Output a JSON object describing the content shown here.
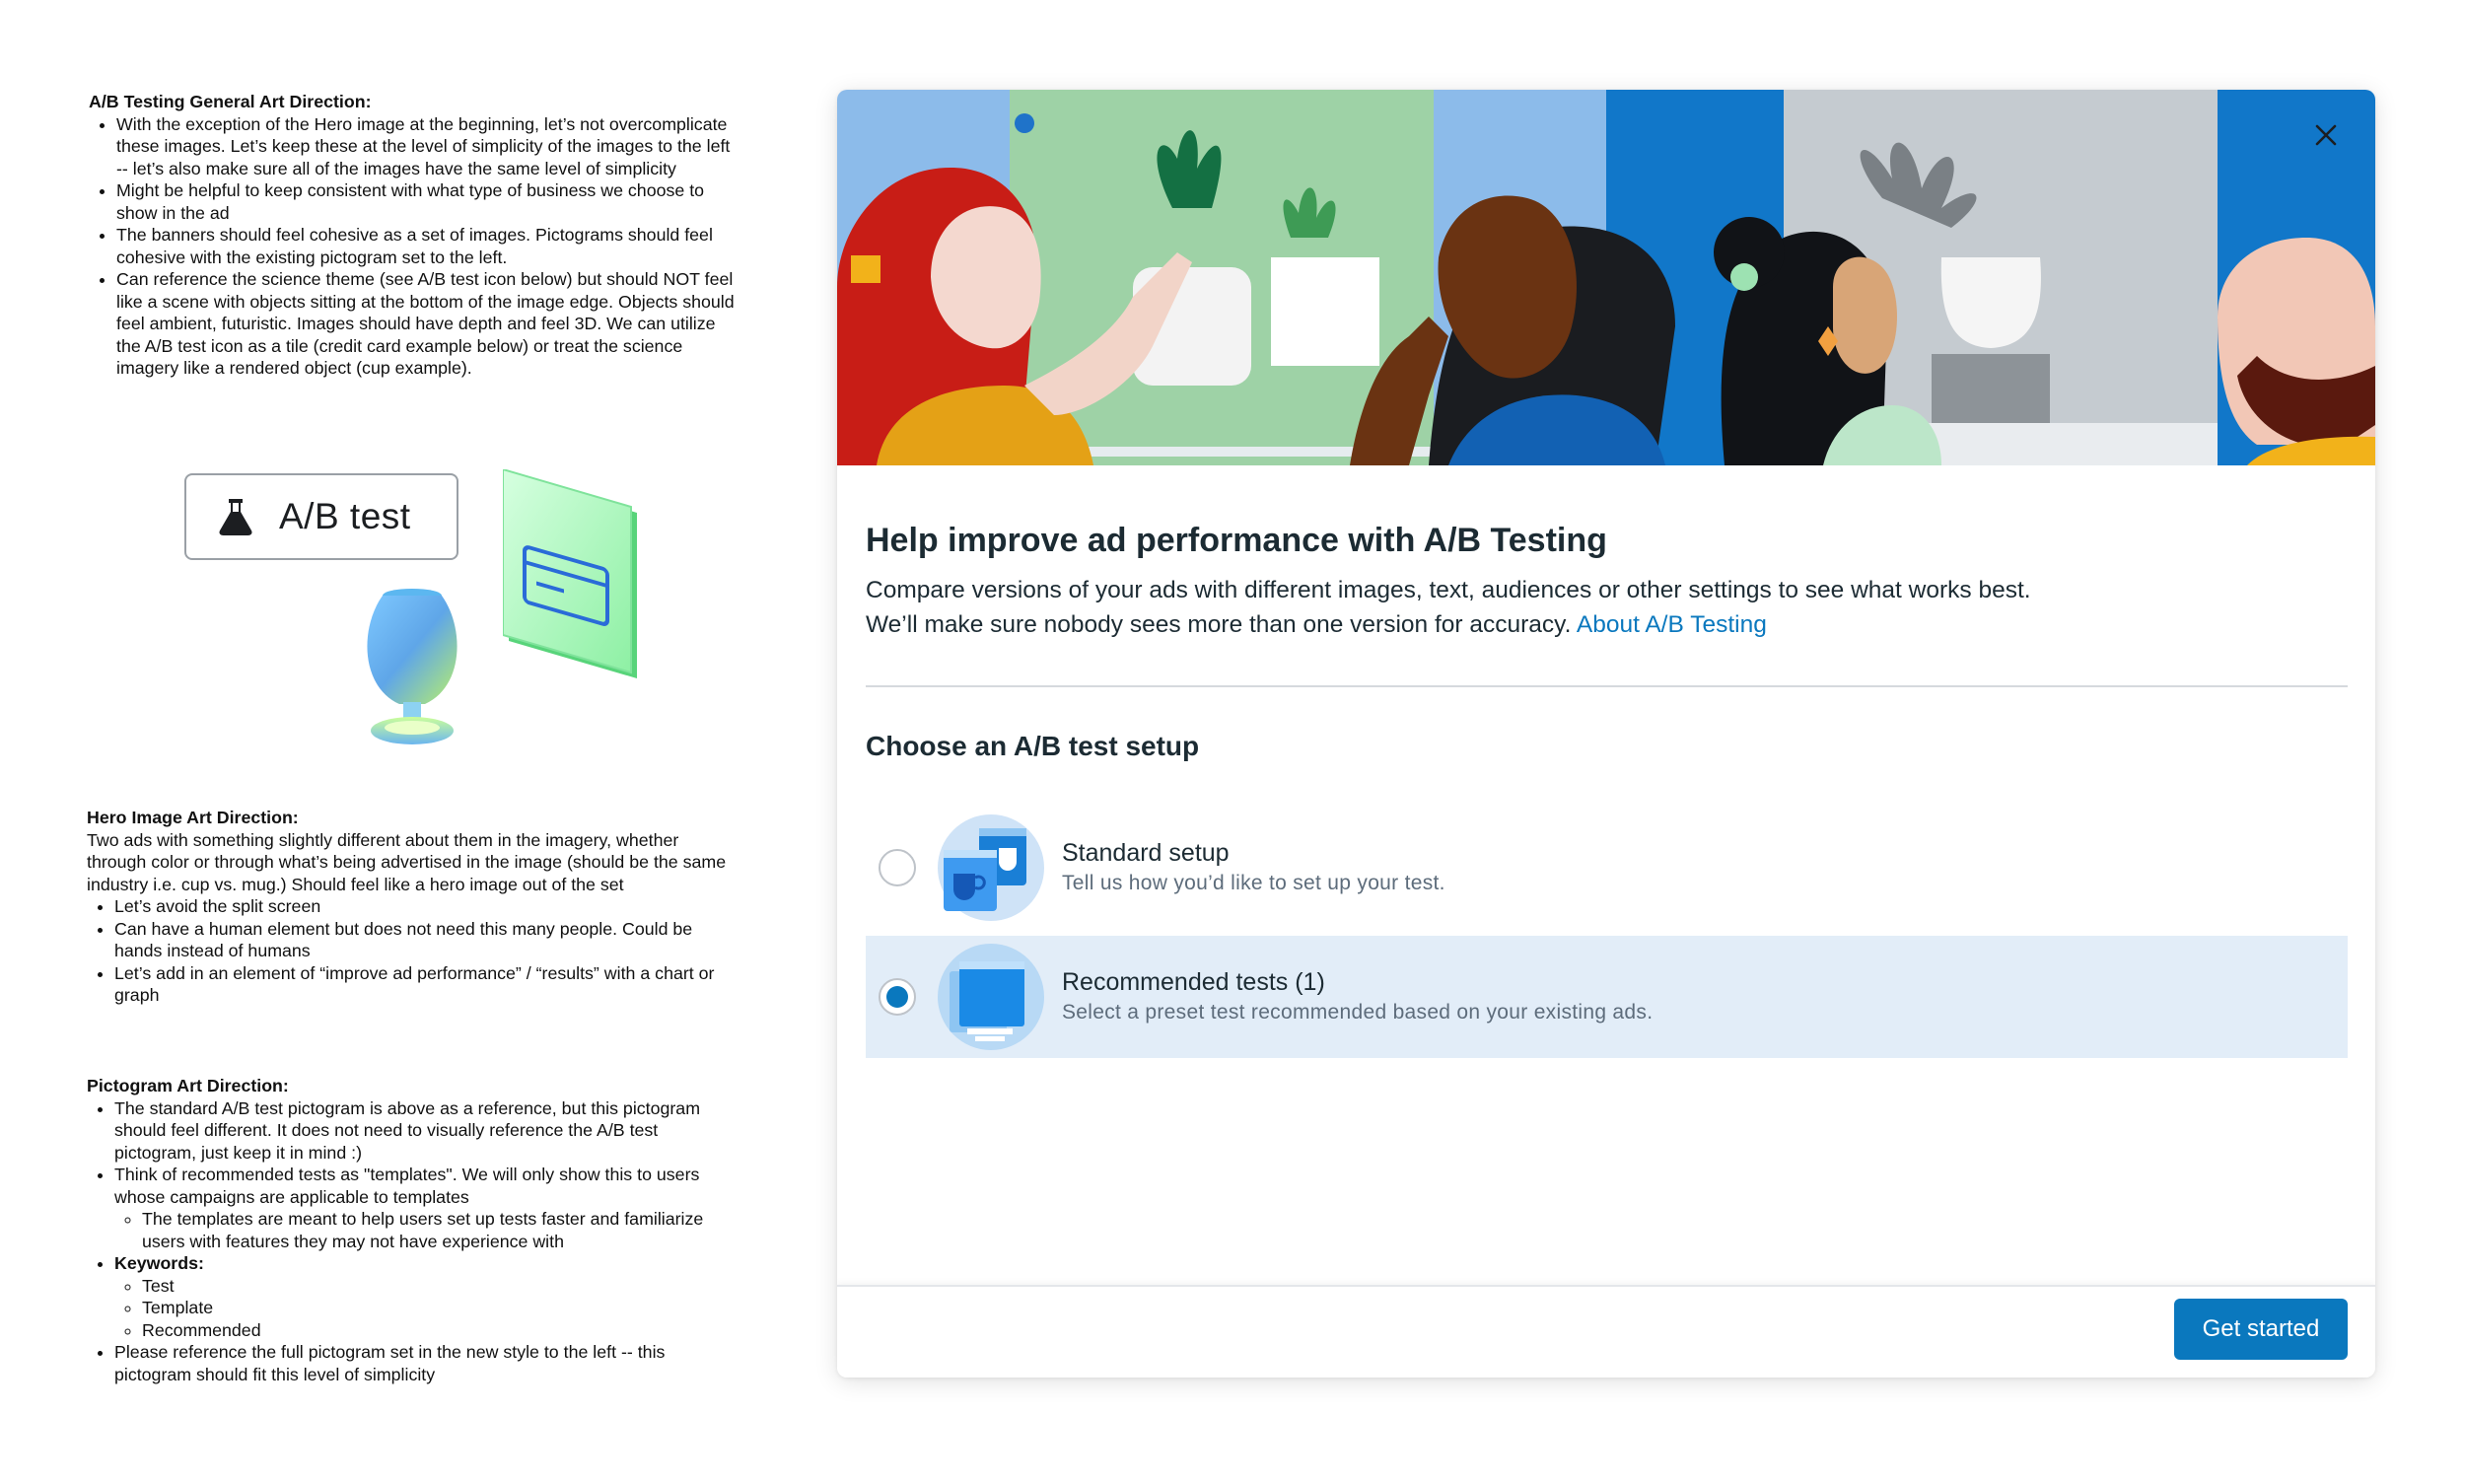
{
  "notes": {
    "ab_section": {
      "heading": "A/B Testing General Art Direction:",
      "bullets": [
        "With the exception of the Hero image at the beginning, let’s not overcomplicate these images. Let’s keep these at the level of simplicity of the images to the left -- let’s also make sure all of the images have the same level of simplicity",
        "Might be helpful to keep consistent with what type of business we choose to show in the ad",
        "The banners should feel cohesive as a set of images. Pictograms should feel cohesive with the existing pictogram set to the left.",
        "Can reference the science theme (see A/B test icon below) but should NOT feel like a scene with objects sitting at the bottom of the image edge. Objects should feel ambient, futuristic. Images should have depth and feel 3D. We can utilize the A/B test icon as a tile (credit card example below) or treat the science imagery like a rendered object (cup example)."
      ]
    },
    "ab_chip_label": "A/B test",
    "hero_section": {
      "heading": "Hero Image Art Direction:",
      "intro": "Two ads with something slightly different about them in the imagery, whether through color or through what’s being advertised in the image (should be the same industry i.e. cup vs. mug.) Should feel like a hero image out of the set",
      "bullets": [
        "Let’s avoid the split screen",
        "Can have a human element but does not need this many people. Could be hands instead of humans",
        "Let’s add in an element of “improve ad performance” / “results” with a chart or graph"
      ]
    },
    "picto_section": {
      "heading": "Pictogram Art Direction:",
      "b1": "The standard A/B test pictogram is above as a reference, but this pictogram should feel different. It does not need to visually reference the A/B test pictogram, just keep it in mind :)",
      "b2": "Think of recommended tests as \"templates\". We will only show this to users whose campaigns are applicable to templates",
      "b2_sub": "The templates are meant to help users set up tests faster and familiarize users with features they may not have experience with",
      "b3": "Keywords:",
      "keywords": [
        "Test",
        "Template",
        "Recommended"
      ],
      "b4": "Please reference the full pictogram set in the new style to the left -- this pictogram should fit this level of simplicity"
    }
  },
  "dialog": {
    "title": "Help improve ad performance with A/B Testing",
    "description": "Compare versions of your ads with different images, text, audiences or other settings to see what works best. We’ll make sure nobody sees more than one version for accuracy.",
    "link": "About A/B Testing",
    "section_title": "Choose an A/B test setup",
    "options": [
      {
        "title": "Standard setup",
        "subtitle": "Tell us how you’d like to set up your test.",
        "selected": false
      },
      {
        "title": "Recommended tests (1)",
        "subtitle": "Select a preset test recommended based on your existing ads.",
        "selected": true
      }
    ],
    "primary_button": "Get started",
    "close_icon": "close-icon"
  },
  "colors": {
    "accent": "#0a78be",
    "selected_row": "#e2edf8",
    "text_primary": "#1c2b33",
    "text_secondary": "#5d6c7b"
  }
}
